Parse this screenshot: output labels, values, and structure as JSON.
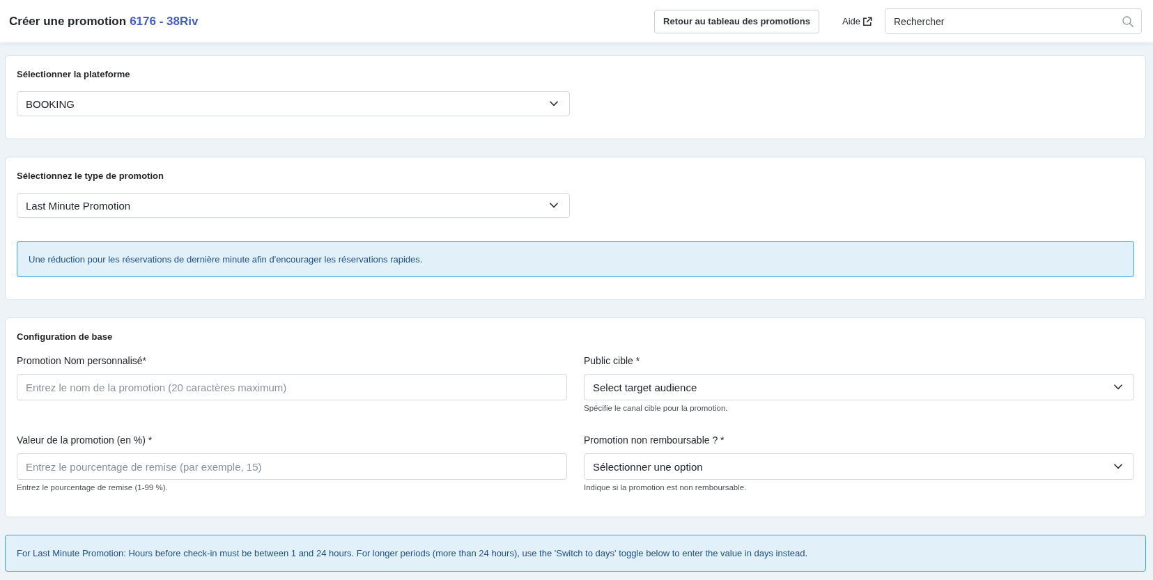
{
  "header": {
    "title": "Créer une promotion",
    "promotion_code": "6176 - 38Riv",
    "back_button": "Retour au tableau des promotions",
    "help_link": "Aide",
    "search": {
      "placeholder": "Rechercher"
    }
  },
  "sections": [
    {
      "kind": "select",
      "heading": "Sélectionner la plateforme",
      "value": "BOOKING"
    },
    {
      "kind": "select",
      "heading": "Sélectionnez le type de promotion",
      "value": "Last Minute Promotion",
      "info": "Une réduction pour les réservations de dernière minute afin d'encourager les réservations rapides."
    },
    {
      "kind": "fields",
      "heading": "Configuration de base",
      "fields": [
        {
          "kind": "text",
          "label": "Promotion Nom personnalisé*",
          "placeholder": "Entrez le nom de la promotion (20 caractères maximum)"
        },
        {
          "kind": "select",
          "label": "Public cible *",
          "value": "Select target audience",
          "help": "Spécifie le canal cible pour la promotion."
        },
        {
          "kind": "text",
          "label": "Valeur de la promotion (en %) *",
          "placeholder": "Entrez le pourcentage de remise (par exemple, 15)",
          "help": "Entrez le pourcentage de remise (1-99 %)."
        },
        {
          "kind": "select",
          "label": "Promotion non remboursable ? *",
          "value": "Sélectionner une option",
          "help": "Indique si la promotion est non remboursable."
        }
      ]
    }
  ],
  "notice": "For Last Minute Promotion: Hours before check-in must be between 1 and 24 hours. For longer periods (more than 24 hours), use the 'Switch to days' toggle below to enter the value in days instead."
}
